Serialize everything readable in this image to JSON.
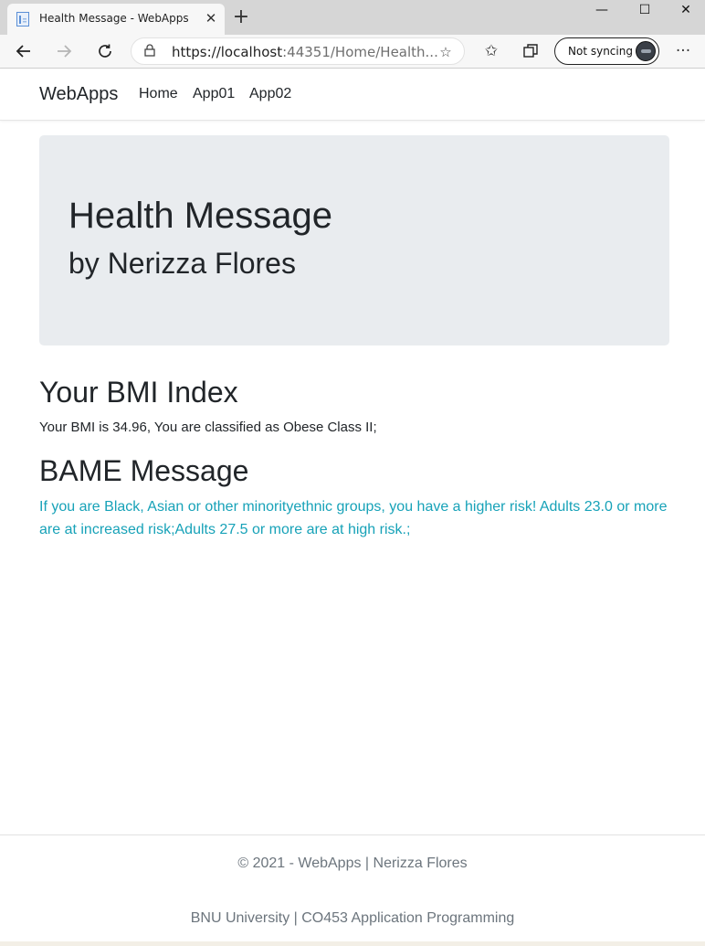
{
  "browser": {
    "tab_title": "Health Message - WebApps",
    "tab_close": "✕",
    "new_tab": "+",
    "url_host": "https://localhost",
    "url_rest": ":44351/Home/Health...",
    "sync_label": "Not syncing",
    "minimize": "—",
    "maximize": "☐",
    "close": "✕",
    "more": "···"
  },
  "navbar": {
    "brand": "WebApps",
    "links": [
      "Home",
      "App01",
      "App02"
    ]
  },
  "jumbotron": {
    "title": "Health Message",
    "subtitle": "by Nerizza Flores"
  },
  "bmi": {
    "heading": "Your BMI Index",
    "message": "Your BMI is 34.96, You are classified as Obese Class II;"
  },
  "bame": {
    "heading": "BAME Message",
    "message": "If you are Black, Asian or other minorityethnic groups, you have a higher risk! Adults 23.0 or more are at increased risk;Adults 27.5 or more are at high risk.;"
  },
  "footer": {
    "copyright": "© 2021 - WebApps | Nerizza Flores",
    "course": "BNU University | CO453 Application Programming"
  },
  "colors": {
    "bame_text": "#17a2b8",
    "jumbotron_bg": "#e9ecef",
    "footer_text": "#6c757d"
  }
}
